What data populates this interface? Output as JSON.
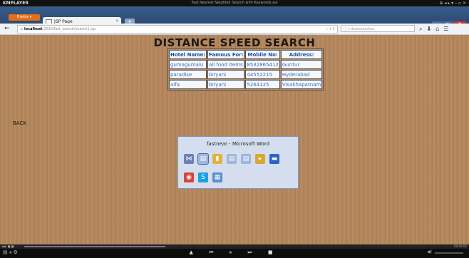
{
  "player": {
    "logo": "KMPLAYER",
    "title": "Fast Nearest Neighbor Search with Keywords.avi",
    "controls": "⊕ ◂ ▸ ▾ – ▫ ✕"
  },
  "browser": {
    "menu_label": "Firefox ▾",
    "tab_label": "JSP Page",
    "tab_close": "×",
    "new_tab": "+",
    "win_min": "–",
    "win_max": "▫",
    "win_close": "✕",
    "back_glyph": "←",
    "url_host": "localhost",
    "url_path": ":2020/fast_search/search1.jsp",
    "url_tools": "☆ ▾ C",
    "search_text": "▢ ▾ diaxsearches",
    "nav_icons": "⌕⬇⌂☰"
  },
  "page": {
    "heading": "DISTANCE SPEED SEARCH",
    "back_link": "BACK",
    "table": {
      "headers": [
        "Hotel Name:",
        "Famous For:",
        "Mobile No:",
        "Address:"
      ],
      "rows": [
        [
          "gumagumalu",
          "all food items",
          "8532865412",
          "Guntur"
        ],
        [
          "paradise",
          "biryani",
          "44552215",
          "Hyderabad"
        ],
        [
          "alfa",
          "biryani",
          "5264125",
          "Visakhapatnam"
        ]
      ]
    }
  },
  "switcher": {
    "title": "fastnear - Microsoft Word",
    "icons_row1": [
      {
        "name": "bowtie-app-icon",
        "glyph": "⋈",
        "color": "#6d7fb8"
      },
      {
        "name": "document-window-icon",
        "glyph": "▤",
        "color": "#9fb6dd"
      },
      {
        "name": "folder-icon",
        "glyph": "▮",
        "color": "#e1b33b"
      },
      {
        "name": "document-window-icon-2",
        "glyph": "▤",
        "color": "#9fb6dd"
      },
      {
        "name": "document-window-icon-3",
        "glyph": "▤",
        "color": "#9fb6dd"
      },
      {
        "name": "folder-arrow-icon",
        "glyph": "▸",
        "color": "#d9a832"
      },
      {
        "name": "monitor-icon",
        "glyph": "▬",
        "color": "#2b64c4"
      }
    ],
    "icons_row2": [
      {
        "name": "chrome-icon",
        "glyph": "◉",
        "color": "#d84437"
      },
      {
        "name": "skype-icon",
        "glyph": "S",
        "color": "#1ea1e3"
      },
      {
        "name": "screenshot-app-icon",
        "glyph": "▦",
        "color": "#5b8ed1"
      }
    ]
  },
  "progress": {
    "left_text": "◀ ▶ ■ ■",
    "right_text": "00:02:02",
    "fraction": 0.33
  },
  "transport": {
    "left": "▤ ⏸ ⚙",
    "mid": "▲ ⏮ ⏸ ⏭ ■",
    "vol": "◀)"
  }
}
